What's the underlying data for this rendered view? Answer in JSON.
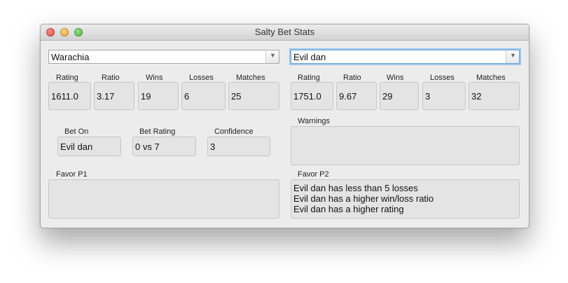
{
  "window": {
    "title": "Salty Bet Stats"
  },
  "player1": {
    "name": "Warachia",
    "stats": {
      "rating": "1611.0",
      "ratio": "3.17",
      "wins": "19",
      "losses": "6",
      "matches": "25"
    }
  },
  "player2": {
    "name": "Evil dan",
    "stats": {
      "rating": "1751.0",
      "ratio": "9.67",
      "wins": "29",
      "losses": "3",
      "matches": "32"
    }
  },
  "labels": {
    "rating": "Rating",
    "ratio": "Ratio",
    "wins": "Wins",
    "losses": "Losses",
    "matches": "Matches",
    "bet_on": "Bet On",
    "bet_rating": "Bet Rating",
    "confidence": "Confidence",
    "warnings": "Warnings",
    "favor_p1": "Favor P1",
    "favor_p2": "Favor P2"
  },
  "bet": {
    "bet_on": "Evil dan",
    "bet_rating": "0 vs 7",
    "confidence": "3"
  },
  "warnings": [],
  "favor_p1": [],
  "favor_p2": [
    "Evil dan has less than 5 losses",
    "Evil dan has a higher win/loss ratio",
    "Evil dan has a higher rating"
  ],
  "icons": {
    "dropdown": "chevron-down-icon"
  }
}
